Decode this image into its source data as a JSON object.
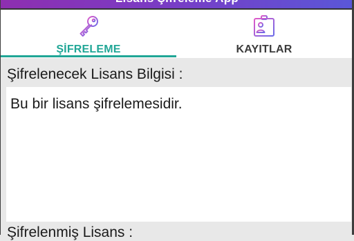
{
  "app": {
    "title": "Lisans Şifreleme App"
  },
  "tabs": [
    {
      "label": "ŞİFRELEME",
      "icon": "key-icon",
      "active": true
    },
    {
      "label": "KAYITLAR",
      "icon": "id-badge-icon",
      "active": false
    }
  ],
  "main": {
    "source_label": "Şifrelenecek Lisans Bilgisi :",
    "source_value": "Bu bir lisans şifrelemesidir.",
    "result_label": "Şifrelenmiş Lisans :"
  },
  "colors": {
    "accent": "#20a696",
    "header_start": "#8e2fb0",
    "header_end": "#5a57d8",
    "icon_gradient_start": "#e05ac8",
    "icon_gradient_end": "#6a6ae8"
  }
}
